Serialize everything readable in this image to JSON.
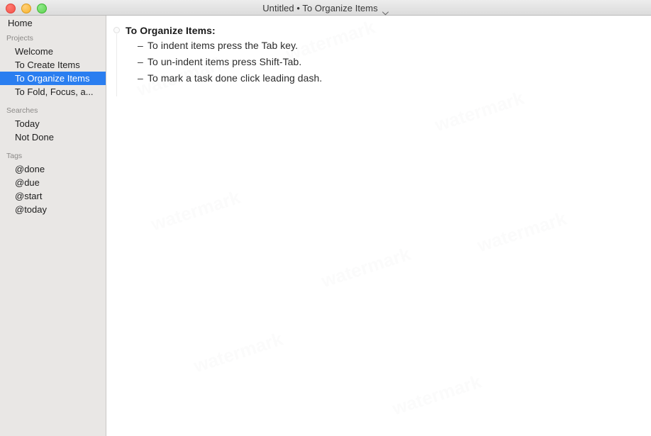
{
  "window": {
    "title": "Untitled • To Organize Items",
    "title_chevron_icon": "chevron-down-icon",
    "traffic_lights": {
      "close_label": "close",
      "minimize_label": "minimize",
      "maximize_label": "maximize"
    }
  },
  "sidebar": {
    "home_label": "Home",
    "sections": [
      {
        "header": "Projects",
        "items": [
          {
            "label": "Welcome",
            "selected": false
          },
          {
            "label": "To Create Items",
            "selected": false
          },
          {
            "label": "To Organize Items",
            "selected": true
          },
          {
            "label": "To Fold, Focus, a...",
            "selected": false
          }
        ]
      },
      {
        "header": "Searches",
        "items": [
          {
            "label": "Today",
            "selected": false
          },
          {
            "label": "Not Done",
            "selected": false
          }
        ]
      },
      {
        "header": "Tags",
        "items": [
          {
            "label": "@done",
            "selected": false
          },
          {
            "label": "@due",
            "selected": false
          },
          {
            "label": "@start",
            "selected": false
          },
          {
            "label": "@today",
            "selected": false
          }
        ]
      }
    ]
  },
  "content": {
    "heading": "To Organize Items:",
    "fold_handle_icon": "fold-circle-icon",
    "items": [
      {
        "dash": "–",
        "text": "To indent items press the Tab key."
      },
      {
        "dash": "–",
        "text": "To un-indent items press Shift-Tab."
      },
      {
        "dash": "–",
        "text": "To mark a task done click leading dash."
      }
    ]
  },
  "colors": {
    "selection_blue": "#2a7ef0",
    "sidebar_bg": "#e9e7e5",
    "sidebar_header_text": "#8b8987",
    "content_bg": "#ffffff",
    "titlebar_bg": "#e4e4e4"
  },
  "watermark": {
    "text": "watermark"
  }
}
